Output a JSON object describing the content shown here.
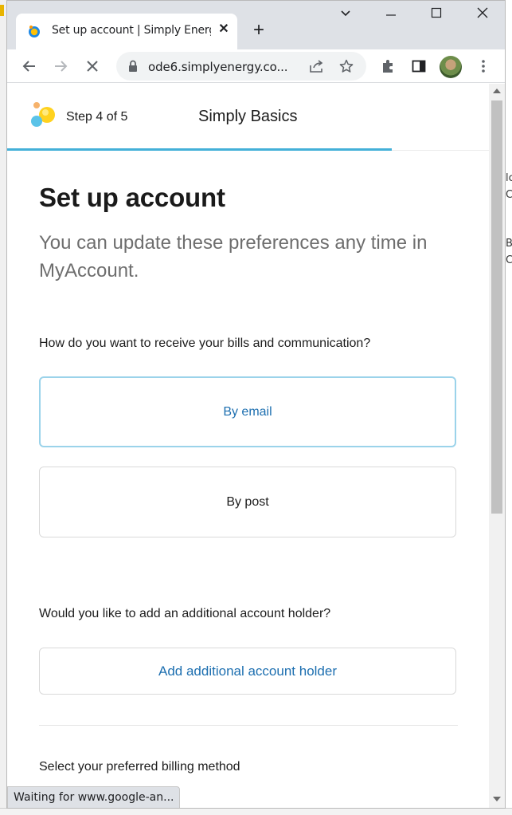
{
  "browser": {
    "tab_title": "Set up account | Simply Energ",
    "url": "ode6.simplyenergy.co..."
  },
  "header": {
    "step": "Step 4 of 5",
    "plan": "Simply Basics"
  },
  "main": {
    "title": "Set up account",
    "subtitle": "You can update these preferences any time in MyAccount.",
    "bills_question": "How do you want to receive your bills and communication?",
    "option_email": "By email",
    "option_post": "By post",
    "holder_question": "Would you like to add an additional account holder?",
    "add_holder": "Add additional account holder",
    "billing_question": "Select your preferred billing method"
  },
  "status": {
    "text": "Waiting for www.google-an..."
  },
  "background": {
    "right_text_1": "lc",
    "right_text_2": "C",
    "right_text_3": "B:",
    "right_text_4": "C"
  },
  "colors": {
    "accent": "#43b0d8",
    "link": "#1d6fb0",
    "selected_border": "#9bd3ea"
  },
  "icons": {
    "back": "arrow-left-icon",
    "forward": "arrow-right-icon",
    "stop": "stop-loading-icon",
    "lock": "lock-icon",
    "share": "share-icon",
    "bookmark": "star-icon",
    "extensions": "puzzle-icon",
    "side_panel": "side-panel-icon",
    "menu": "kebab-menu-icon"
  }
}
